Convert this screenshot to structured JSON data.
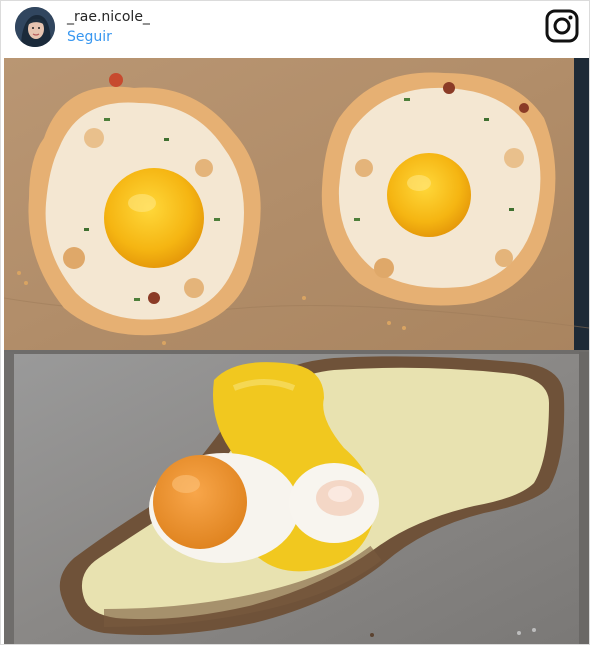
{
  "post": {
    "username": "_rae.nicole_",
    "follow_label": "Seguir",
    "logo_icon": "instagram-icon",
    "avatar_icon": "profile-avatar"
  },
  "colors": {
    "follow_blue": "#3897f0",
    "username_text": "#262626",
    "border": "#dbdbdb",
    "parchment": "#b3906e",
    "tray": "#8c8c8c",
    "yolk": "#f2b011",
    "cheese_sauce": "#f1c81f"
  }
}
